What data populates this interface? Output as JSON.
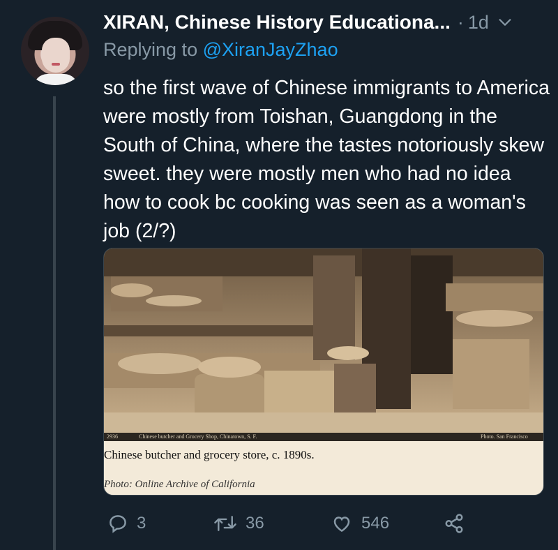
{
  "tweet": {
    "author_name": "XIRAN, Chinese History Educationa...",
    "separator": "·",
    "time": "1d",
    "replying_prefix": "Replying to ",
    "replying_handle": "@XiranJayZhao",
    "text": "so the first wave of Chinese immigrants to America were mostly from Toishan, Guangdong in the South of China, where the tastes notoriously skew sweet. they were mostly men who had no idea how to cook bc cooking was seen as a woman's job (2/?)"
  },
  "card": {
    "plate_number": "2936",
    "plate_title": "Chinese butcher and Grocery Shop, Chinatown, S. F.",
    "plate_credit": "Photo. San Francisco",
    "caption": "Chinese butcher and grocery store, c. 1890s.",
    "credit": "Photo: Online Archive of California"
  },
  "actions": {
    "replies": "3",
    "retweets": "36",
    "likes": "546"
  },
  "icons": [
    "chevron-down-icon",
    "reply-icon",
    "retweet-icon",
    "like-icon",
    "share-icon"
  ],
  "colors": {
    "background": "#15202b",
    "secondary_text": "#8899a6",
    "link": "#1da1f2",
    "thread_line": "#38444d"
  }
}
